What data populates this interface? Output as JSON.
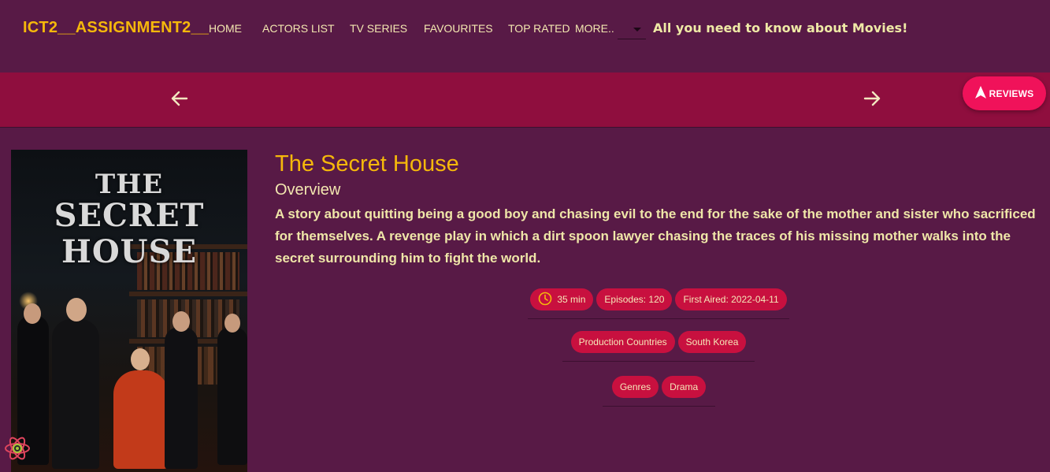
{
  "nav": {
    "brand": "ICT2__ASSIGNMENT2__",
    "links": [
      "HOME",
      "ACTORS LIST",
      "TV SERIES",
      "FAVOURITES",
      "TOP RATED",
      "MORE.."
    ],
    "tagline": "All you need to know about Movies!"
  },
  "carousel": {
    "reviews_label": "REVIEWS"
  },
  "poster": {
    "title_lines": [
      "THE",
      "SECRET",
      "HOUSE"
    ]
  },
  "details": {
    "title": "The Secret House",
    "overview_heading": "Overview",
    "overview": "A story about quitting being a good boy and chasing evil to the end for the sake of the mother and sister who sacrificed for themselves. A revenge play in which a dirt spoon lawyer chasing the traces of his missing mother walks into the secret surrounding him to fight the world.",
    "runtime": "35 min",
    "episodes": "Episodes: 120",
    "first_aired": "First Aired: 2022-04-11",
    "production_label": "Production Countries",
    "production_country": "South Korea",
    "genres_label": "Genres",
    "genre": "Drama"
  },
  "colors": {
    "background": "#581a46",
    "carousel": "#8f0e3e",
    "accent": "#f5b80b",
    "chip": "#c8103f",
    "reviews_button": "#f0125a"
  },
  "icons": [
    "arrow-left-icon",
    "arrow-right-icon",
    "navigation-icon",
    "clock-icon",
    "react-logo-icon"
  ]
}
